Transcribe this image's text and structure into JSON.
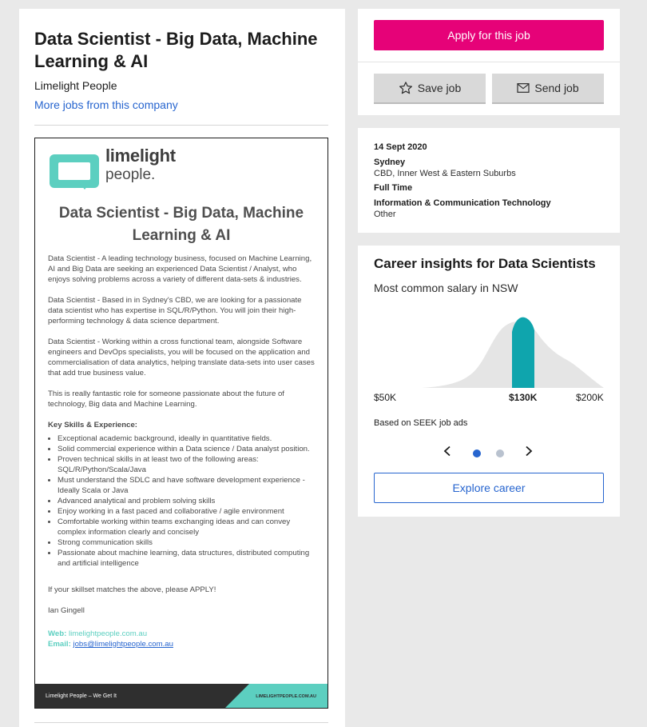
{
  "job": {
    "title": "Data Scientist - Big Data, Machine Learning & AI",
    "company": "Limelight People",
    "more_link": "More jobs from this company"
  },
  "ad": {
    "logo_line1": "limelight",
    "logo_line2": "people.",
    "title": "Data Scientist - Big Data, Machine Learning & AI",
    "paragraphs": [
      "Data Scientist - A leading technology business, focused on Machine Learning, AI and Big Data are seeking an experienced Data Scientist / Analyst, who enjoys solving problems across a variety of different data-sets & industries.",
      "Data Scientist - Based in in Sydney's CBD, we are looking for a passionate data scientist who has expertise in SQL/R/Python. You will join their high-performing technology & data science department.",
      "Data Scientist - Working within a cross functional team, alongside Software engineers and DevOps specialists, you will be focused on the application and commercialisation of data analytics, helping translate data-sets into user cases that add true business value.",
      "This is really fantastic role for someone passionate about the future of technology, Big data and Machine Learning."
    ],
    "skills_heading": "Key Skills & Experience:",
    "skills": [
      "Exceptional academic background, ideally in quantitative fields.",
      "Solid commercial experience within a Data science / Data analyst position.",
      "Proven technical skills in at least two of the following areas: SQL/R/Python/Scala/Java",
      "Must understand the SDLC and have software development experience - Ideally Scala or Java",
      "Advanced analytical and problem solving skills",
      "Enjoy working in a fast paced and collaborative / agile environment",
      "Comfortable working within teams exchanging ideas and can convey complex information clearly and concisely",
      "Strong communication skills",
      "Passionate about machine learning, data structures, distributed computing and artificial intelligence"
    ],
    "closing": "If your skillset matches the above, please APPLY!",
    "signature": "Ian Gingell",
    "web_label": "Web:",
    "web_value": "limelightpeople.com.au",
    "email_label": "Email:",
    "email_value": "jobs@limelightpeople.com.au",
    "footer_left": "Limelight People – We Get It",
    "footer_right": "LIMELIGHTPEOPLE.COM.AU"
  },
  "actions": {
    "apply": "Apply for this job",
    "save": "Save job",
    "send": "Send job"
  },
  "info": {
    "date": "14 Sept 2020",
    "location": "Sydney",
    "area": "CBD, Inner West & Eastern Suburbs",
    "work_type": "Full Time",
    "classification": "Information & Communication Technology",
    "sub_classification": "Other"
  },
  "career": {
    "title": "Career insights for Data Scientists",
    "subtitle": "Most common salary in NSW",
    "tick_low": "$50K",
    "tick_mid": "$130K",
    "tick_high": "$200K",
    "based_on": "Based on SEEK job ads",
    "carousel_pages": 2,
    "carousel_active": 1,
    "explore": "Explore career"
  },
  "chart_data": {
    "type": "area",
    "x_ticks": [
      "$50K",
      "$130K",
      "$200K"
    ],
    "highlight": "$130K",
    "colors": {
      "area": "#e5e5e5",
      "highlight": "#0fa5ad"
    }
  },
  "colors": {
    "apply": "#e60278",
    "link": "#2765cf",
    "brand_teal": "#5ccfc0"
  }
}
